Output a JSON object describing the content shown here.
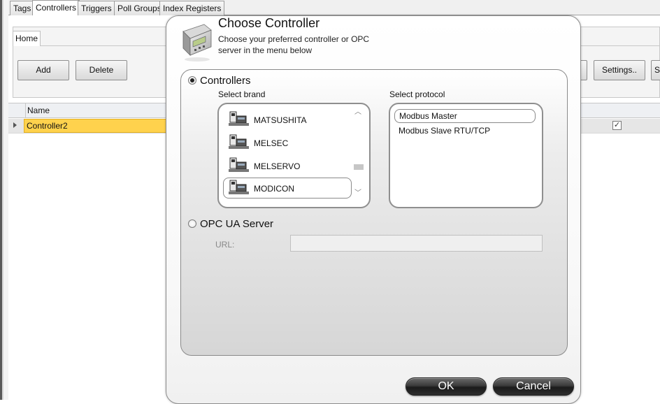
{
  "tabs": [
    "Tags",
    "Controllers",
    "Triggers",
    "Poll Groups",
    "Index Registers"
  ],
  "active_tab": "Controllers",
  "ribbon": {
    "tab_label": "Home",
    "add_label": "Add",
    "delete_label": "Delete",
    "settings_label": "Settings..",
    "partial_button_label": "Sl"
  },
  "grid": {
    "column_name": "Name",
    "rows": [
      {
        "name": "Controller2",
        "checked": true
      }
    ]
  },
  "dialog": {
    "title": "Choose Controller",
    "subtitle": "Choose your preferred controller or OPC server in the menu below",
    "controllers_option": "Controllers",
    "select_brand_label": "Select brand",
    "select_protocol_label": "Select protocol",
    "brands": [
      "MATSUSHITA",
      "MELSEC",
      "MELSERVO",
      "MODICON"
    ],
    "selected_brand": "MODICON",
    "protocols": [
      "Modbus Master",
      "Modbus Slave RTU/TCP"
    ],
    "selected_protocol": "Modbus Master",
    "opc_option": "OPC UA Server",
    "url_label": "URL:",
    "url_value": "",
    "ok_label": "OK",
    "cancel_label": "Cancel",
    "controllers_selected": true
  },
  "colors": {
    "selected_row": "#ffd24d",
    "pill_button": "#2e2e2e"
  }
}
